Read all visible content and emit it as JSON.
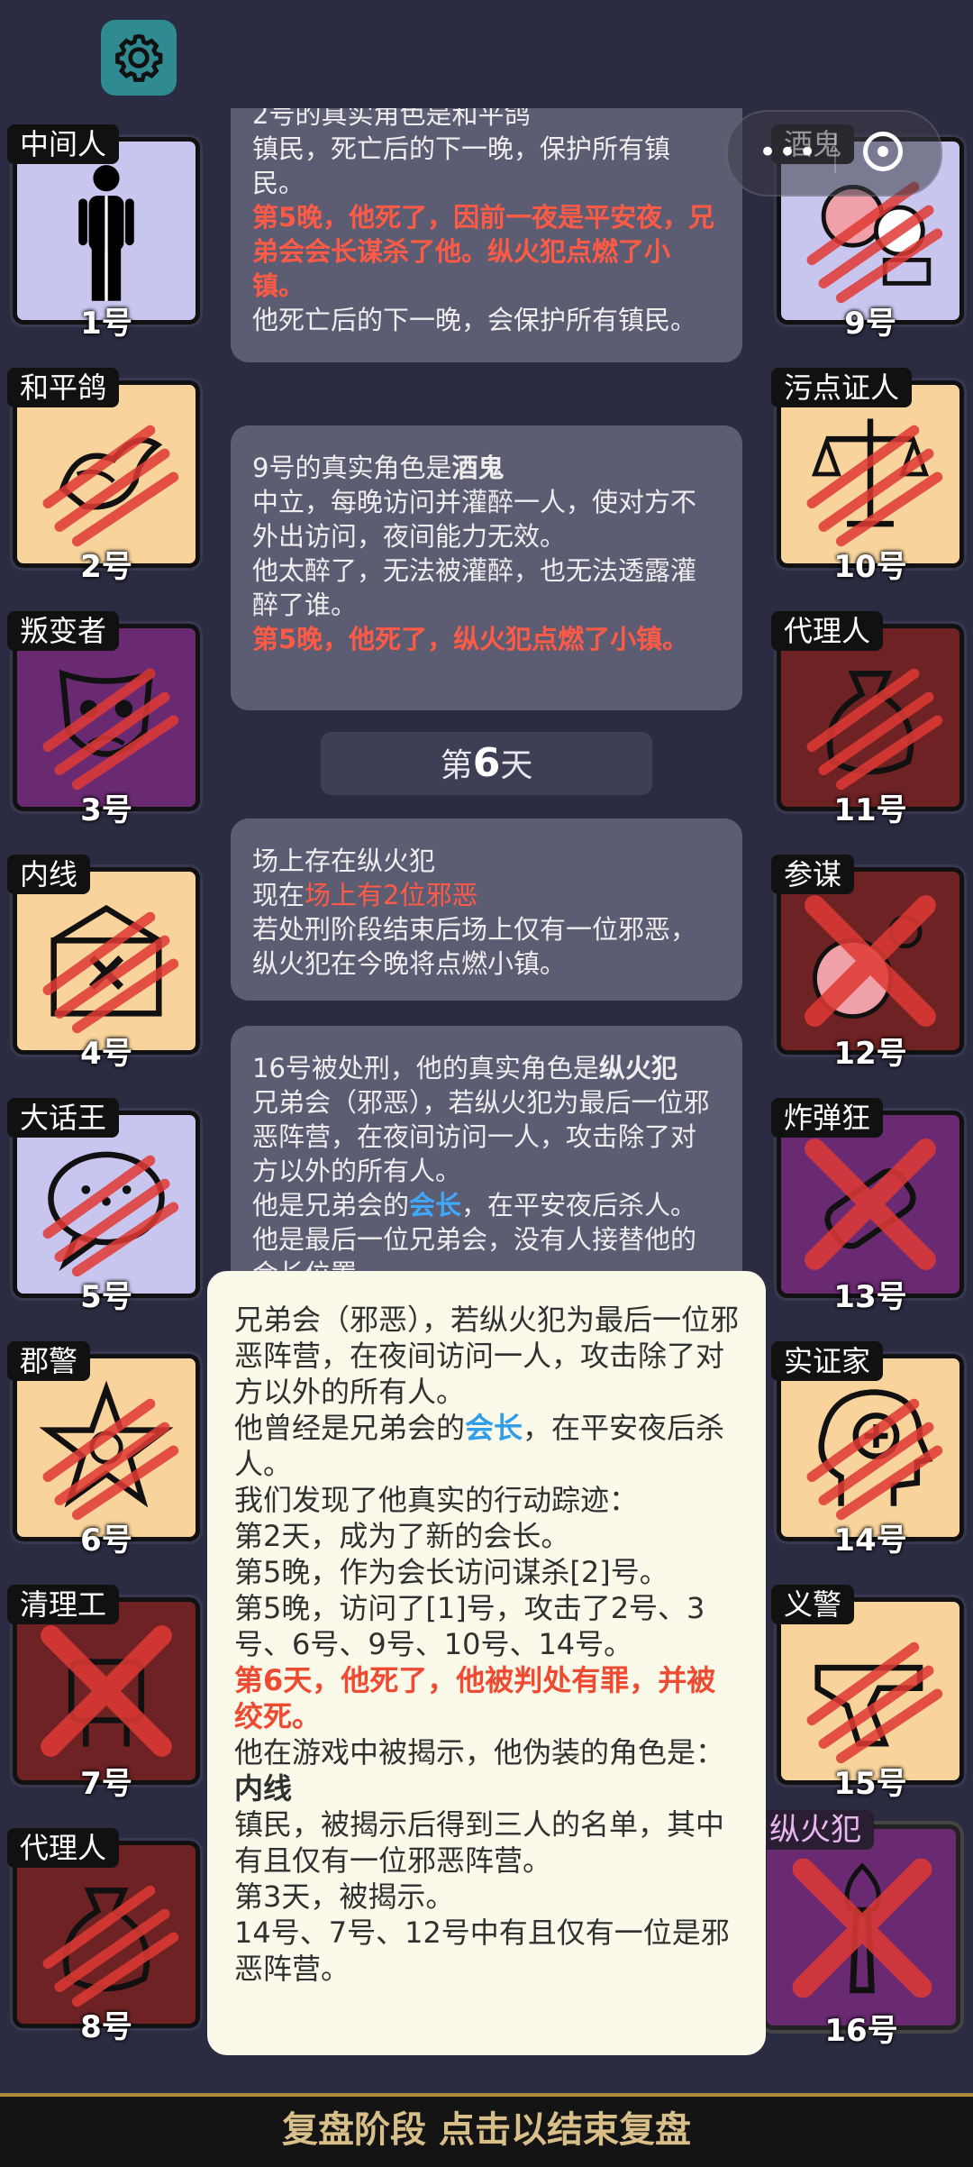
{
  "topbar": {
    "settings_icon": "gear-icon",
    "menu_dots": "•••",
    "close_icon": "target-icon"
  },
  "players": [
    {
      "label": "中间人",
      "num": "1号",
      "color": "#c8c6ee",
      "dead": false
    },
    {
      "label": "和平鸽",
      "num": "2号",
      "color": "#f8d49c",
      "dead": true
    },
    {
      "label": "叛变者",
      "num": "3号",
      "color": "#6a2a72",
      "dead": true
    },
    {
      "label": "内线",
      "num": "4号",
      "color": "#f8d49c",
      "dead": true
    },
    {
      "label": "大话王",
      "num": "5号",
      "color": "#c8c6ee",
      "dead": true
    },
    {
      "label": "郡警",
      "num": "6号",
      "color": "#f8d49c",
      "dead": true
    },
    {
      "label": "清理工",
      "num": "7号",
      "color": "#6e2224",
      "dead": true,
      "crossed": true
    },
    {
      "label": "代理人",
      "num": "8号",
      "color": "#6e2224",
      "dead": true
    },
    {
      "label": "酒鬼",
      "num": "9号",
      "color": "#c8c6ee",
      "dead": true
    },
    {
      "label": "污点证人",
      "num": "10号",
      "color": "#f8d49c",
      "dead": true
    },
    {
      "label": "代理人",
      "num": "11号",
      "color": "#6e2224",
      "dead": true
    },
    {
      "label": "参谋",
      "num": "12号",
      "color": "#6e2224",
      "dead": true,
      "crossed": true
    },
    {
      "label": "炸弹狂",
      "num": "13号",
      "color": "#6a2a72",
      "dead": true,
      "crossed": true
    },
    {
      "label": "实证家",
      "num": "14号",
      "color": "#f8d49c",
      "dead": true
    },
    {
      "label": "义警",
      "num": "15号",
      "color": "#f8d49c",
      "dead": true
    },
    {
      "label": "纵火犯",
      "num": "16号",
      "color": "#6a2a72",
      "dead": true,
      "crossed": true
    }
  ],
  "log": {
    "msg1": {
      "partial": "2号的真实角色是和平鸽",
      "line1": "镇民，死亡后的下一晚，保护所有镇民。",
      "red": "第5晚，他死了，因前一夜是平安夜，兄弟会会长谋杀了他。纵火犯点燃了小镇。",
      "line2": "他死亡后的下一晚，会保护所有镇民。"
    },
    "msg2": {
      "title_prefix": "9号的真实角色是",
      "role": "酒鬼",
      "line1": "中立，每晚访问并灌醉一人，使对方不外出访问，夜间能力无效。",
      "line2": "他太醉了，无法被灌醉，也无法透露灌醉了谁。",
      "red": "第5晚，他死了，纵火犯点燃了小镇。"
    },
    "day": {
      "prefix": "第",
      "number": "6",
      "suffix": "天"
    },
    "msg3": {
      "line1": "场上存在纵火犯",
      "line2_prefix": "现在",
      "line2_red": "场上有2位邪恶",
      "line3": "若处刑阶段结束后场上仅有一位邪恶，纵火犯在今晚将点燃小镇。"
    },
    "msg4": {
      "title_prefix": "16号被处刑，他的真实角色是",
      "role": "纵火犯",
      "line1": "兄弟会（邪恶），若纵火犯为最后一位邪恶阵营，在夜间访问一人，攻击除了对方以外的所有人。",
      "line2_prefix": "他是兄弟会的",
      "line2_blue": "会长",
      "line2_suffix": "，在平安夜后杀人。他是最后一位兄弟会，没有人接替他的会长位置"
    }
  },
  "popup": {
    "p1": "兄弟会（邪恶），若纵火犯为最后一位邪恶阵营，在夜间访问一人，攻击除了对方以外的所有人。",
    "p2_prefix": "他曾经是兄弟会的",
    "p2_blue": "会长",
    "p2_suffix": "，在平安夜后杀人。",
    "p3": "我们发现了他真实的行动踪迹：",
    "p4": "第2天，成为了新的会长。",
    "p5": "第5晚，作为会长访问谋杀[2]号。",
    "p6": "第5晚，访问了[1]号，攻击了2号、3号、6号、9号、10号、14号。",
    "p7_red": "第6天，他死了，他被判处有罪，并被绞死。",
    "p8_prefix": "他在游戏中被揭示，他伪装的角色是：",
    "p8_role": "内线",
    "p9": "镇民，被揭示后得到三人的名单，其中有且仅有一位邪恶阵营。",
    "p10": "第3天，被揭示。",
    "p11": "14号、7号、12号中有且仅有一位是邪恶阵营。"
  },
  "footer": {
    "label": "复盘阶段 点击以结束复盘"
  }
}
